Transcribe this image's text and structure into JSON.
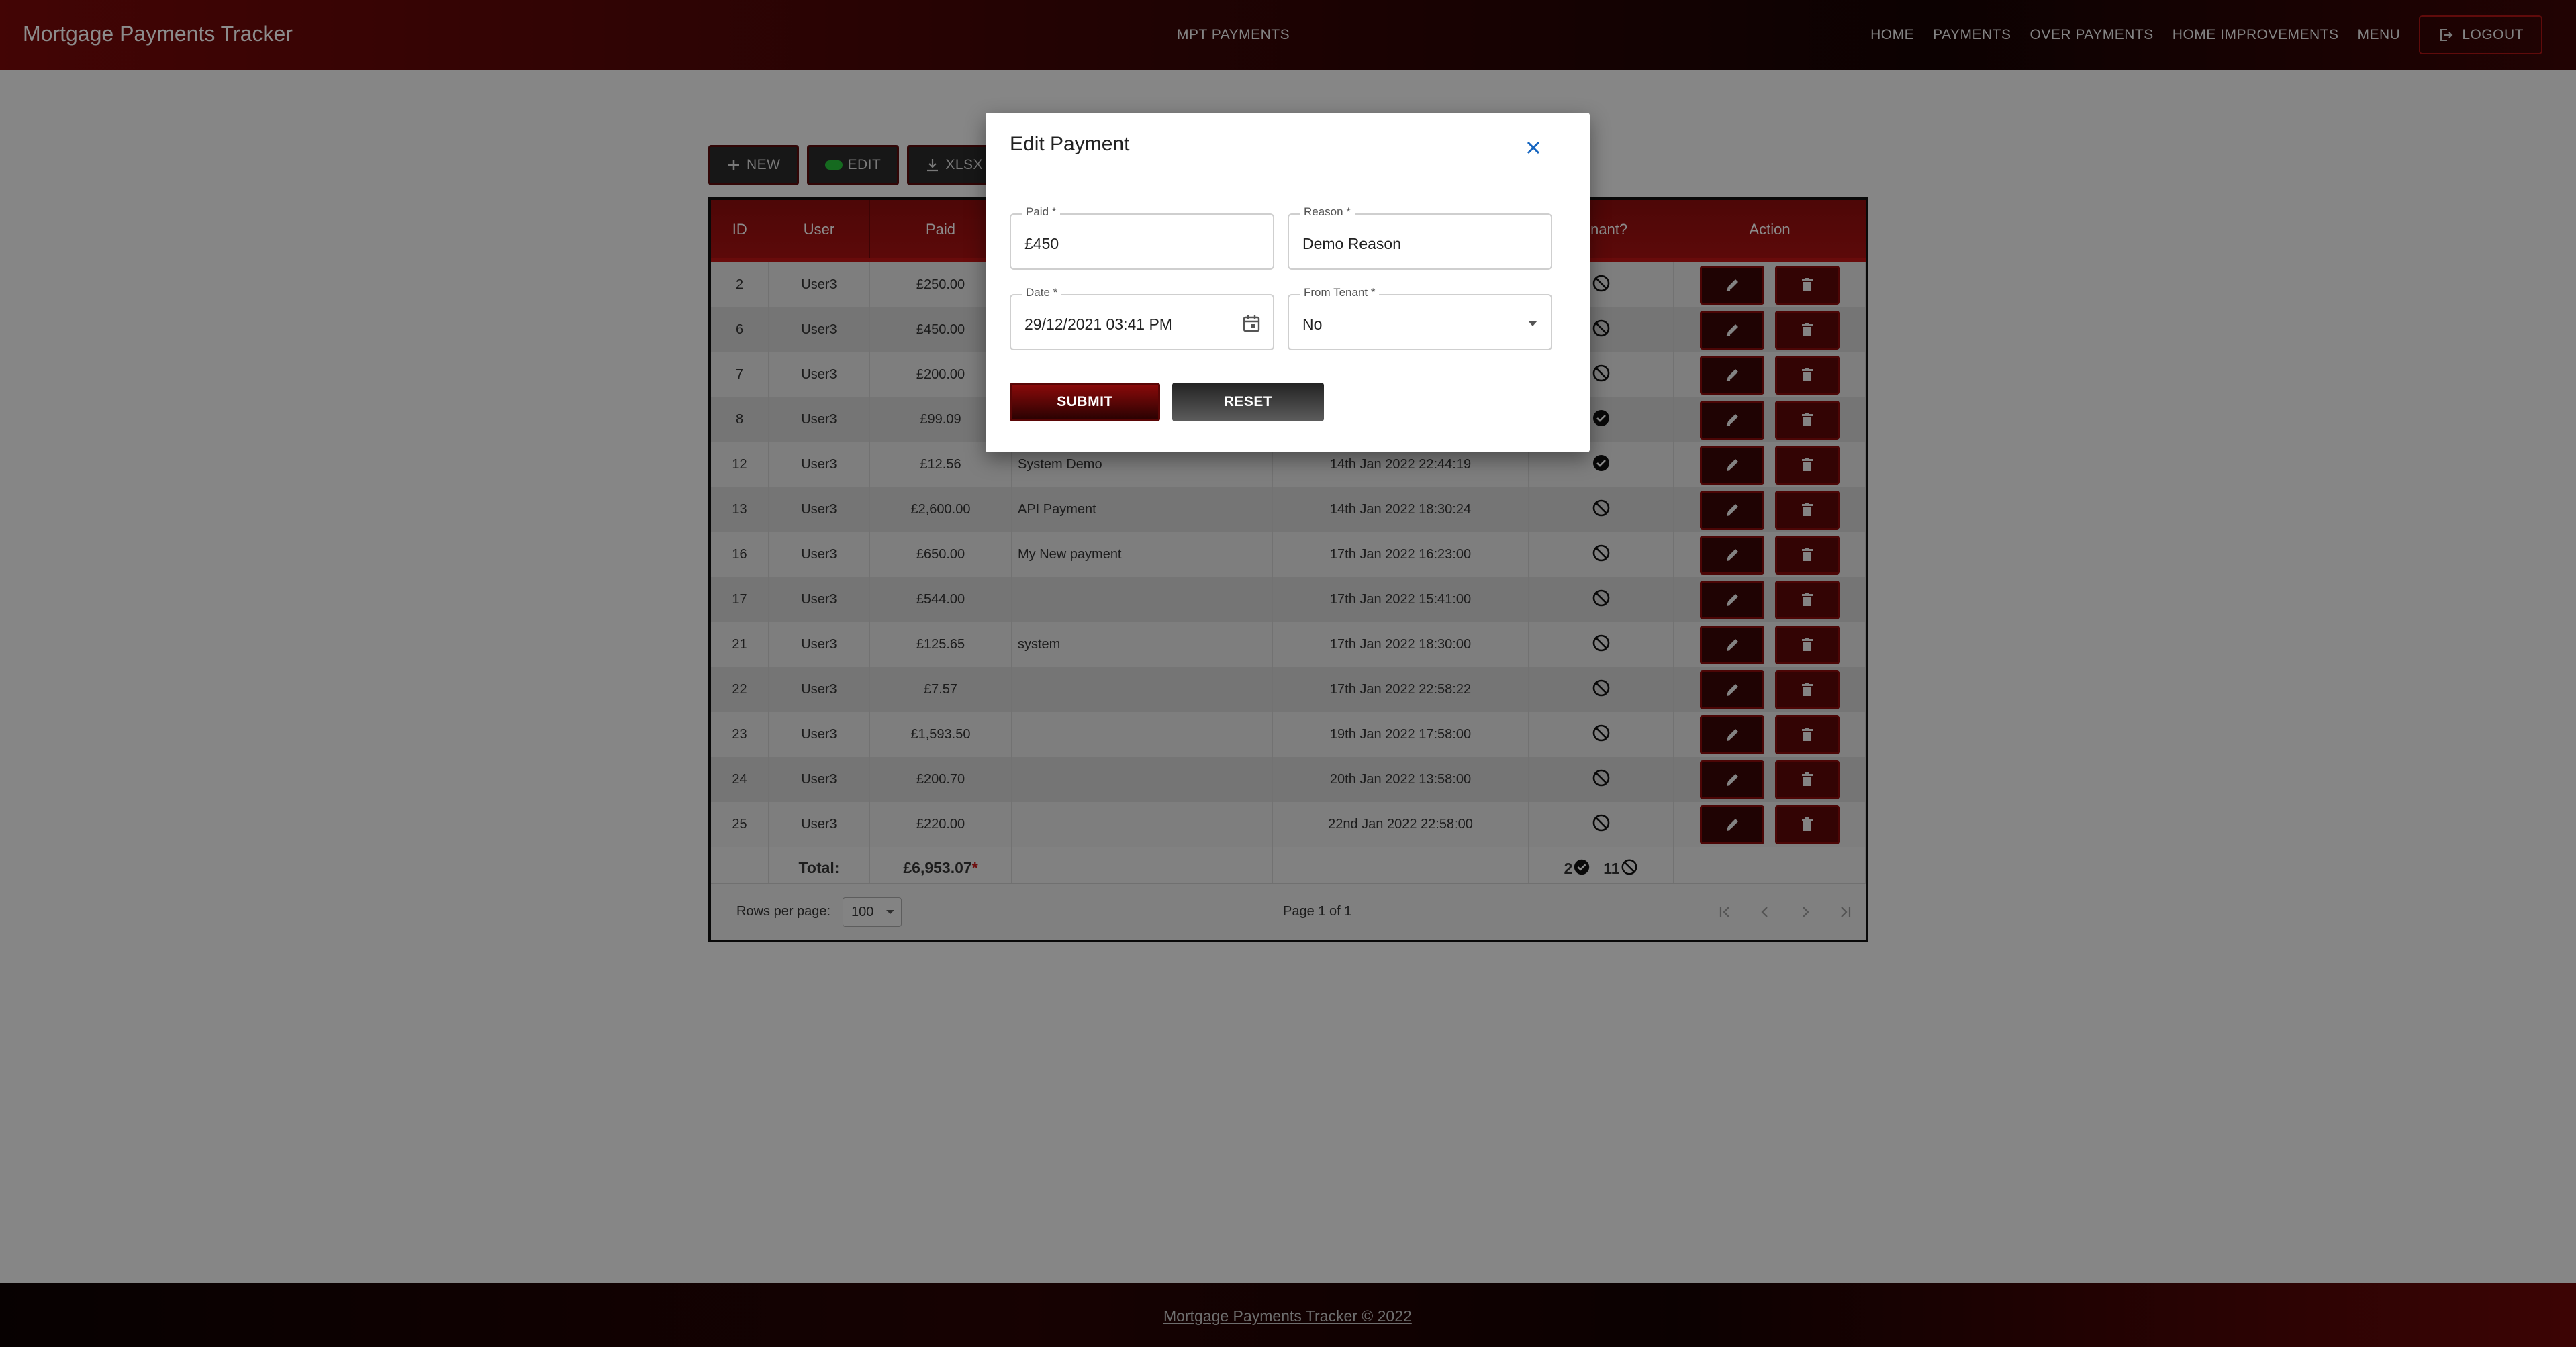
{
  "navbar": {
    "brand": "Mortgage Payments Tracker",
    "center": "MPT PAYMENTS",
    "links": [
      "HOME",
      "PAYMENTS",
      "OVER PAYMENTS",
      "HOME IMPROVEMENTS",
      "MENU"
    ],
    "logout": "LOGOUT"
  },
  "toolbar": {
    "new": "NEW",
    "edit": "EDIT",
    "xlsx": "XLSX"
  },
  "table": {
    "headers": [
      "ID",
      "User",
      "Paid",
      "",
      "",
      "Tenant?",
      "Action"
    ],
    "rows": [
      {
        "id": "2",
        "user": "User3",
        "paid": "£250.00",
        "reason": "",
        "date": "",
        "tenant": false
      },
      {
        "id": "6",
        "user": "User3",
        "paid": "£450.00",
        "reason": "",
        "date": "",
        "tenant": false
      },
      {
        "id": "7",
        "user": "User3",
        "paid": "£200.00",
        "reason": "",
        "date": "",
        "tenant": false
      },
      {
        "id": "8",
        "user": "User3",
        "paid": "£99.09",
        "reason": "",
        "date": "",
        "tenant": true
      },
      {
        "id": "12",
        "user": "User3",
        "paid": "£12.56",
        "reason": "System Demo",
        "date": "14th Jan 2022 22:44:19",
        "tenant": true
      },
      {
        "id": "13",
        "user": "User3",
        "paid": "£2,600.00",
        "reason": "API Payment",
        "date": "14th Jan 2022 18:30:24",
        "tenant": false
      },
      {
        "id": "16",
        "user": "User3",
        "paid": "£650.00",
        "reason": "My New payment",
        "date": "17th Jan 2022 16:23:00",
        "tenant": false
      },
      {
        "id": "17",
        "user": "User3",
        "paid": "£544.00",
        "reason": "",
        "date": "17th Jan 2022 15:41:00",
        "tenant": false
      },
      {
        "id": "21",
        "user": "User3",
        "paid": "£125.65",
        "reason": "system",
        "date": "17th Jan 2022 18:30:00",
        "tenant": false
      },
      {
        "id": "22",
        "user": "User3",
        "paid": "£7.57",
        "reason": "",
        "date": "17th Jan 2022 22:58:22",
        "tenant": false
      },
      {
        "id": "23",
        "user": "User3",
        "paid": "£1,593.50",
        "reason": "",
        "date": "19th Jan 2022 17:58:00",
        "tenant": false
      },
      {
        "id": "24",
        "user": "User3",
        "paid": "£200.70",
        "reason": "",
        "date": "20th Jan 2022 13:58:00",
        "tenant": false
      },
      {
        "id": "25",
        "user": "User3",
        "paid": "£220.00",
        "reason": "",
        "date": "22nd Jan 2022 22:58:00",
        "tenant": false
      }
    ],
    "total_label": "Total:",
    "total_paid": "£6,953.07",
    "total_asterisk": "*",
    "tenant_yes_count": "2",
    "tenant_no_count": "11"
  },
  "pager": {
    "rows_per_page_label": "Rows per page:",
    "rows_per_page": "100",
    "page_info": "Page 1 of 1"
  },
  "dialog": {
    "title": "Edit Payment",
    "paid_label": "Paid *",
    "paid_value": "£450",
    "reason_label": "Reason *",
    "reason_value": "Demo Reason",
    "date_label": "Date *",
    "date_value": "29/12/2021 03:41 PM",
    "tenant_label": "From Tenant *",
    "tenant_value": "No",
    "submit": "SUBMIT",
    "reset": "RESET"
  },
  "footer": {
    "text": "Mortgage Payments Tracker © 2022"
  },
  "colors": {
    "brand_red": "#8d0d0d",
    "dark": "#160303",
    "close_blue": "#1565c0",
    "tenant_yes": "#111111"
  }
}
